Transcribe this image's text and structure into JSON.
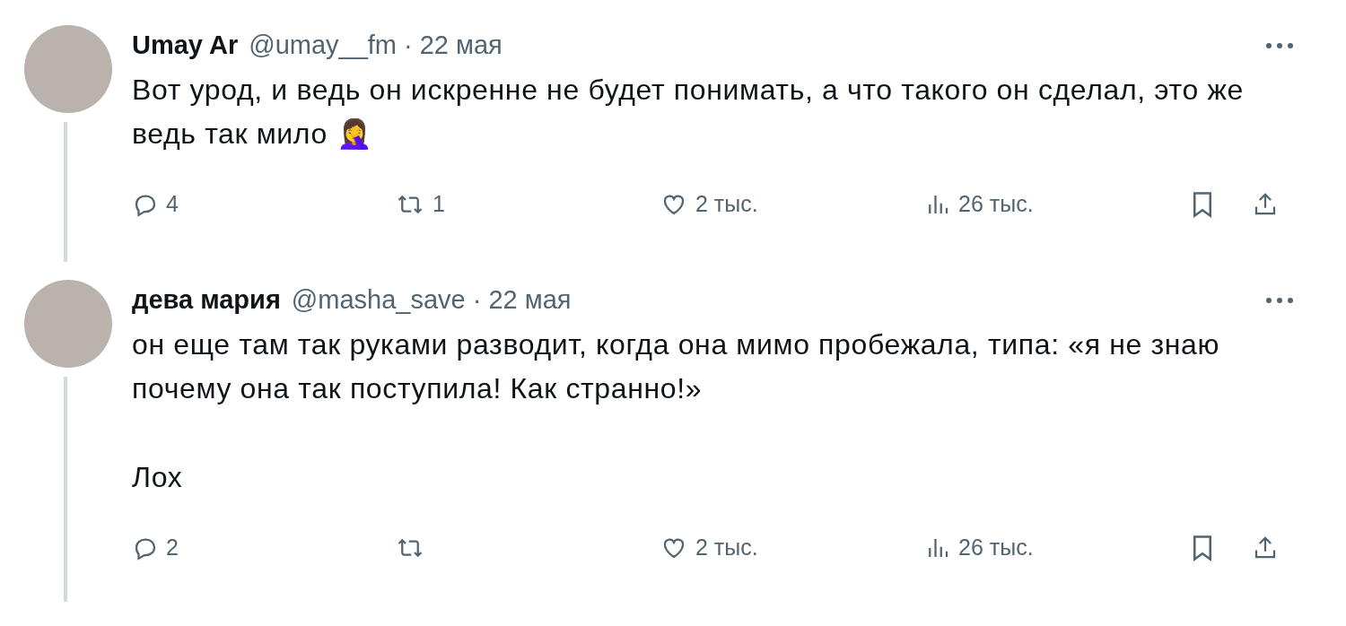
{
  "tweets": [
    {
      "name": "Umay Ar",
      "handle": "@umay__fm",
      "separator": "·",
      "date": "22 мая",
      "paragraphs": [
        "Вот урод, и ведь он искренне не будет понимать, а что такого он сделал, это же ведь так мило 🤦‍♀️"
      ],
      "actions": [
        {
          "kind": "reply",
          "count": "4"
        },
        {
          "kind": "repost",
          "count": "1"
        },
        {
          "kind": "like",
          "count": "2 тыс."
        },
        {
          "kind": "views",
          "count": "26 тыс."
        },
        {
          "kind": "bookmark"
        },
        {
          "kind": "share"
        }
      ]
    },
    {
      "name": "дева мария",
      "handle": "@masha_save",
      "separator": "·",
      "date": "22 мая",
      "paragraphs": [
        "он еще там так руками разводит, когда она мимо пробежала, типа: «я не знаю почему она так поступила! Как странно!»",
        "Лох"
      ],
      "actions": [
        {
          "kind": "reply",
          "count": "2"
        },
        {
          "kind": "repost"
        },
        {
          "kind": "like",
          "count": "2 тыс."
        },
        {
          "kind": "views",
          "count": "26 тыс."
        },
        {
          "kind": "bookmark"
        },
        {
          "kind": "share"
        }
      ]
    }
  ]
}
